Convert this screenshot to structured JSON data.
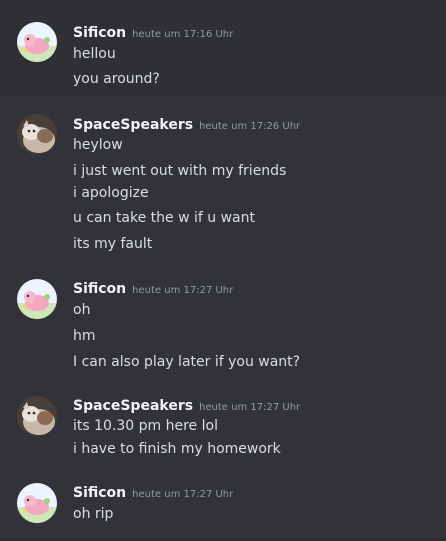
{
  "messages": [
    {
      "author": "Sificon",
      "timestamp": "heute um 17:16 Uhr",
      "avatar_icon": "pink-animal-avatar-icon",
      "lines": [
        "hellou",
        "you around?"
      ]
    },
    {
      "author": "SpaceSpeakers",
      "timestamp": "heute um 17:26 Uhr",
      "avatar_icon": "cat-photo-avatar-icon",
      "lines": [
        "heylow",
        "i just went out with my friends",
        " i apologize",
        "u can take the w if u want",
        "its my fault"
      ]
    },
    {
      "author": "Sificon",
      "timestamp": "heute um 17:27 Uhr",
      "avatar_icon": "pink-animal-avatar-icon",
      "lines": [
        "oh",
        "hm",
        "I can also play later if you want?"
      ]
    },
    {
      "author": "SpaceSpeakers",
      "timestamp": "heute um 17:27 Uhr",
      "avatar_icon": "cat-photo-avatar-icon",
      "lines": [
        "its 10.30 pm here lol",
        " i have to finish my homework"
      ]
    },
    {
      "author": "Sificon",
      "timestamp": "heute um 17:27 Uhr",
      "avatar_icon": "pink-animal-avatar-icon",
      "lines": [
        "oh rip"
      ]
    }
  ],
  "colors": {
    "background": "#313338",
    "username": "#f2f3f5",
    "message_text": "#dbdee1",
    "timestamp": "#949ba4"
  }
}
